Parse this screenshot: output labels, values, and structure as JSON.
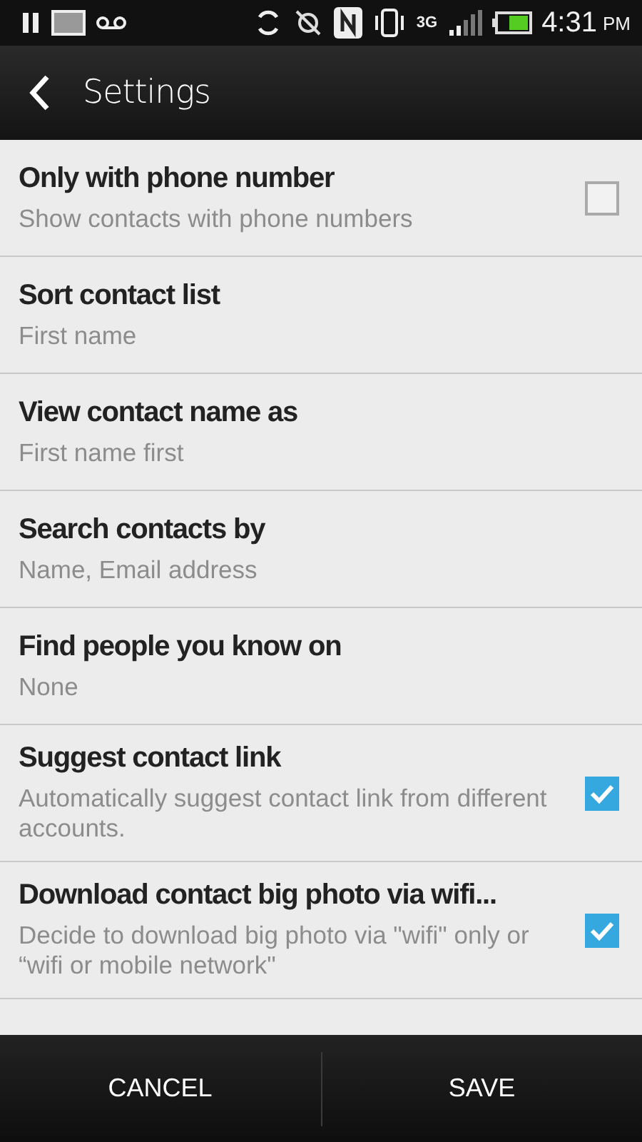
{
  "status_bar": {
    "time": "4:31",
    "ampm": "PM",
    "network": "3G"
  },
  "header": {
    "title": "Settings"
  },
  "settings": [
    {
      "kind": "checkbox",
      "title": "Only with phone number",
      "summary": "Show contacts with phone numbers",
      "checked": false
    },
    {
      "kind": "plain",
      "title": "Sort contact list",
      "summary": "First name"
    },
    {
      "kind": "plain",
      "title": "View contact name as",
      "summary": "First name first"
    },
    {
      "kind": "plain",
      "title": "Search contacts by",
      "summary": "Name, Email address"
    },
    {
      "kind": "plain",
      "title": "Find people you know on",
      "summary": "None"
    },
    {
      "kind": "checkbox",
      "title": "Suggest contact link",
      "summary": "Automatically suggest contact link from different accounts.",
      "checked": true
    },
    {
      "kind": "checkbox",
      "title": "Download contact big photo via wifi...",
      "summary": "Decide to download big photo via \"wifi\" only or “wifi or mobile network\"",
      "checked": true
    }
  ],
  "buttons": [
    {
      "label": "CANCEL"
    },
    {
      "label": "SAVE"
    }
  ]
}
